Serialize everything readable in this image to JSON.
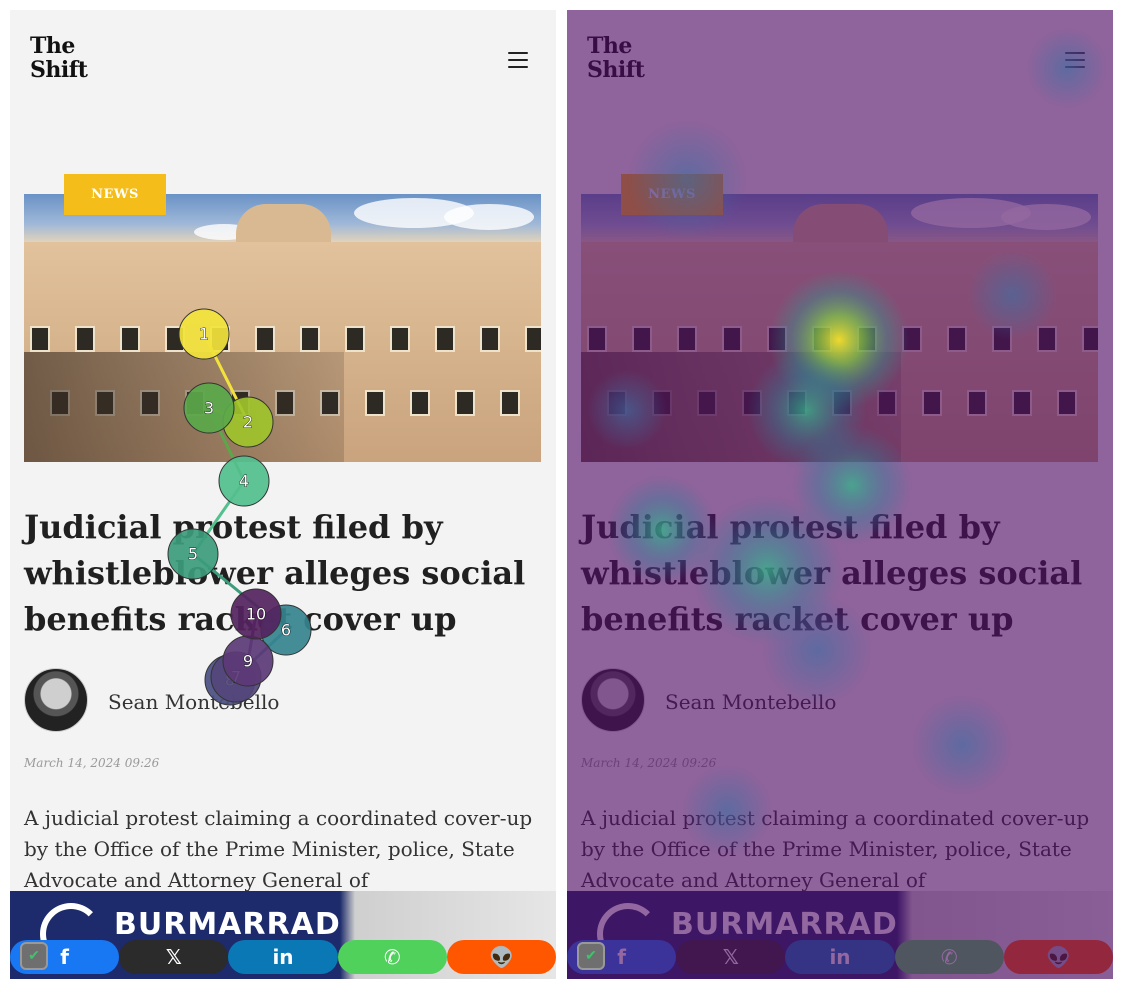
{
  "site": {
    "logo_line1": "The",
    "logo_line2": "Shift"
  },
  "article": {
    "category": "NEWS",
    "headline": "Judicial protest filed by whistleblower alleges social benefits racket cover up",
    "author": "Sean Montebello",
    "date": "March 14, 2024 09:26",
    "body": "A judicial protest claiming a coordinated cover-up by the Office of the Prime Minister, police, State Advocate and Attorney General of"
  },
  "ad": {
    "brand": "BURMARRAD"
  },
  "share": {
    "facebook": "f",
    "x": "𝕏",
    "linkedin": "in",
    "whatsapp": "✆",
    "reddit": "👽"
  },
  "icons": [
    "menu-icon",
    "shield-icon",
    "facebook-icon",
    "x-icon",
    "linkedin-icon",
    "whatsapp-icon",
    "reddit-icon"
  ],
  "colors": {
    "badge": "#f4bd19",
    "facebook": "#1877f2",
    "x": "#2b2b2b",
    "linkedin": "#0a78b5",
    "whatsapp": "#4fd15b",
    "reddit": "#ff5700"
  },
  "gaze": {
    "fixations": [
      {
        "n": "1",
        "color": "#f2e33c"
      },
      {
        "n": "2",
        "color": "#9ec32b"
      },
      {
        "n": "3",
        "color": "#5aa84a"
      },
      {
        "n": "4",
        "color": "#53c08d"
      },
      {
        "n": "5",
        "color": "#3c9c7b"
      },
      {
        "n": "6",
        "color": "#35848f"
      },
      {
        "n": "7",
        "color": "#53457a"
      },
      {
        "n": "8",
        "color": "#4a4f82"
      },
      {
        "n": "9",
        "color": "#5c3a76"
      },
      {
        "n": "10",
        "color": "#54235f"
      }
    ]
  }
}
